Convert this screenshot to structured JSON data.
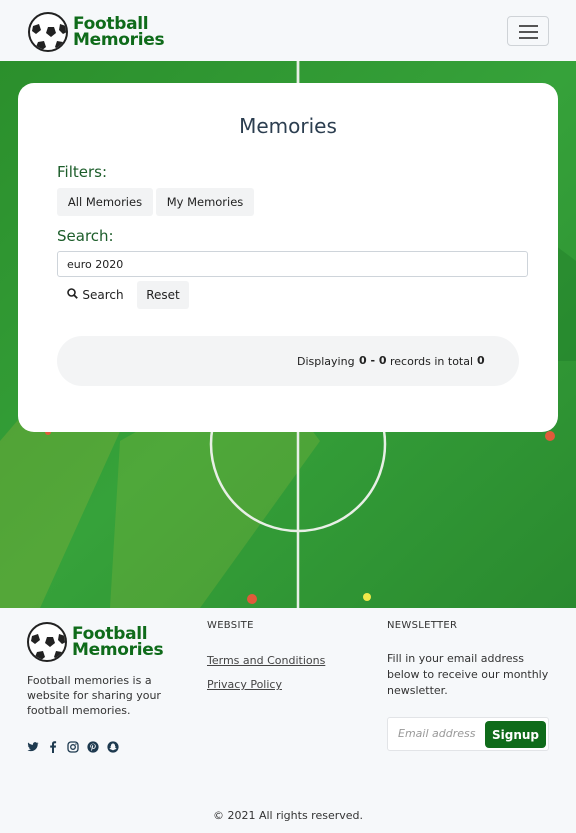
{
  "brand": {
    "line1": "Football",
    "line2": "Memories"
  },
  "card": {
    "title": "Memories",
    "filters_label": "Filters:",
    "filters": [
      "All Memories",
      "My Memories"
    ],
    "search_label": "Search:",
    "search_value": "euro 2020",
    "search_button": "Search",
    "reset_button": "Reset",
    "records": {
      "prefix": "Displaying",
      "range": "0 - 0",
      "middle": "records in total",
      "total": "0"
    }
  },
  "footer": {
    "description": "Football memories is a website for sharing your football memories.",
    "website_heading": "WEBSITE",
    "links": [
      "Terms and Conditions",
      "Privacy Policy"
    ],
    "newsletter_heading": "NEWSLETTER",
    "newsletter_text": "Fill in your email address below to receive our monthly newsletter.",
    "email_placeholder": "Email address",
    "signup_button": "Signup",
    "copyright": "© 2021 All rights reserved.",
    "socials": [
      "twitter-icon",
      "facebook-icon",
      "instagram-icon",
      "pinterest-icon",
      "snapchat-icon"
    ]
  },
  "colors": {
    "brand_green": "#0f6b1a",
    "field_green": "#2f9a2e"
  }
}
